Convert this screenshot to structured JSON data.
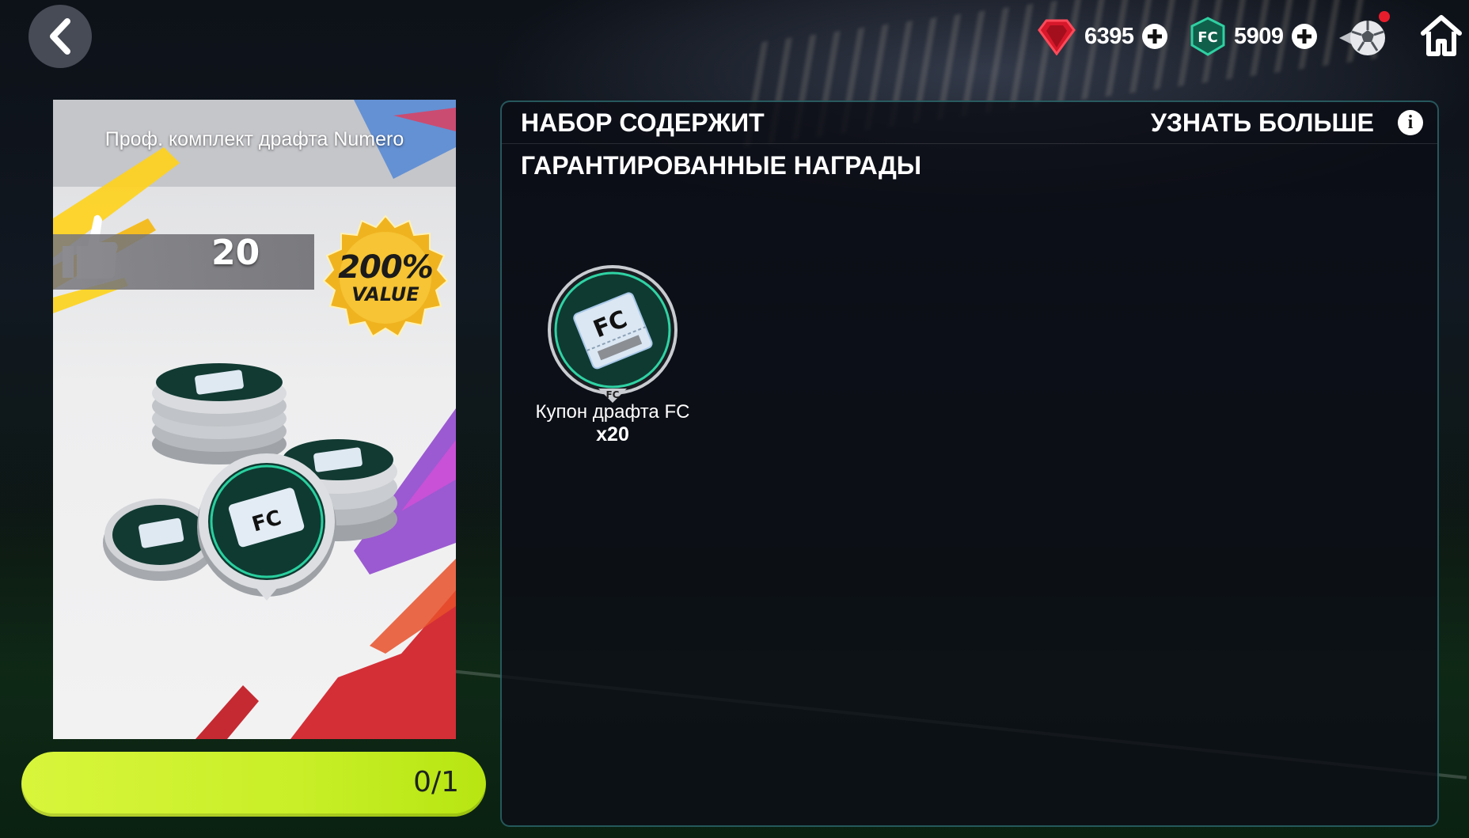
{
  "top_bar": {
    "gems": {
      "value": "6395",
      "icon": "red-gem-icon"
    },
    "fc_points": {
      "value": "5909",
      "icon": "fc-shield-icon"
    },
    "notification": true
  },
  "pack": {
    "title": "Проф. комплект драфта Numero",
    "likes": "20",
    "badge": {
      "line1": "200%",
      "line2": "VALUE"
    },
    "claim_progress": "0/1"
  },
  "contents": {
    "title": "НАБОР СОДЕРЖИТ",
    "learn_more": "УЗНАТЬ БОЛЬШЕ",
    "section": "ГАРАНТИРОВАННЫЕ НАГРАДЫ",
    "rewards": [
      {
        "name": "Купон драфта FC",
        "quantity": "x20"
      }
    ]
  },
  "colors": {
    "claim_bar": "#c8ef27",
    "panel_border": "#3c9696",
    "gem": "#e0192c",
    "fc_shield": "#1fae8a"
  }
}
